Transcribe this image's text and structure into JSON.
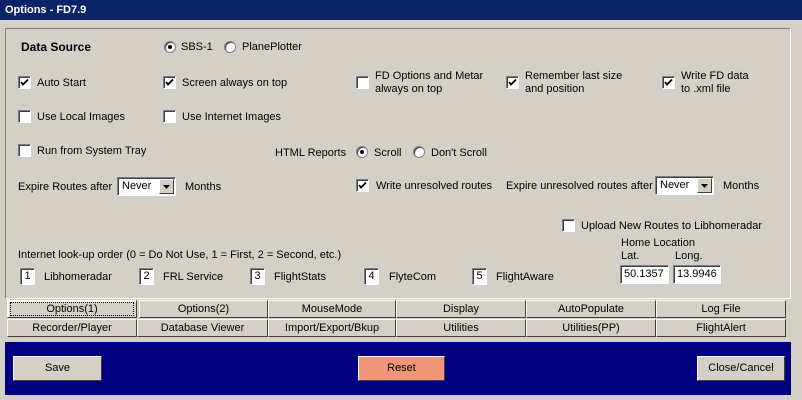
{
  "window": {
    "title": "Options - FD7.9"
  },
  "data_source": {
    "label": "Data Source",
    "options": [
      {
        "label": "SBS-1",
        "selected": true
      },
      {
        "label": "PlanePlotter",
        "selected": false
      }
    ]
  },
  "checkboxes": {
    "auto_start": {
      "label": "Auto Start",
      "checked": true
    },
    "screen_on_top": {
      "label": "Screen always on top",
      "checked": true
    },
    "fd_options_metar": {
      "label_line1": "FD Options and Metar",
      "label_line2": "always on top",
      "checked": false
    },
    "remember_size": {
      "label_line1": "Remember last size",
      "label_line2": "and position",
      "checked": true
    },
    "write_xml": {
      "label_line1": "Write FD data",
      "label_line2": "to .xml file",
      "checked": true
    },
    "use_local_images": {
      "label": "Use Local Images",
      "checked": false
    },
    "use_internet_images": {
      "label": "Use Internet Images",
      "checked": false
    },
    "run_system_tray": {
      "label": "Run from System Tray",
      "checked": false
    },
    "write_unresolved": {
      "label": "Write unresolved routes",
      "checked": true
    },
    "upload_routes": {
      "label": "Upload New Routes to Libhomeradar",
      "checked": false
    }
  },
  "html_reports": {
    "label": "HTML Reports",
    "options": [
      {
        "label": "Scroll",
        "selected": true
      },
      {
        "label": "Don't Scroll",
        "selected": false
      }
    ]
  },
  "expire_routes": {
    "label": "Expire Routes after",
    "value": "Never",
    "unit": "Months"
  },
  "expire_unresolved": {
    "label": "Expire unresolved routes after",
    "value": "Never",
    "unit": "Months"
  },
  "lookup": {
    "label": "Internet look-up order (0 = Do Not Use, 1 = First, 2 = Second, etc.)",
    "items": [
      {
        "order": "1",
        "name": "Libhomeradar"
      },
      {
        "order": "2",
        "name": "FRL Service"
      },
      {
        "order": "3",
        "name": "FlightStats"
      },
      {
        "order": "4",
        "name": "FlyteCom"
      },
      {
        "order": "5",
        "name": "FlightAware"
      }
    ]
  },
  "home_location": {
    "label": "Home Location",
    "lat_label": "Lat.",
    "long_label": "Long.",
    "lat": "50.1357",
    "long": "13.9946"
  },
  "tabs_row1": [
    "Options(1)",
    "Options(2)",
    "MouseMode",
    "Display",
    "AutoPopulate",
    "Log File"
  ],
  "tabs_row2": [
    "Recorder/Player",
    "Database Viewer",
    "Import/Export/Bkup",
    "Utilities",
    "Utilities(PP)",
    "FlightAlert"
  ],
  "active_tab": "Options(1)",
  "buttons": {
    "save": "Save",
    "reset": "Reset",
    "close": "Close/Cancel"
  },
  "colors": {
    "titlebar": "#0a246a",
    "bottom_panel": "#000080",
    "reset_button": "#f09578",
    "face": "#d4d0c8"
  }
}
